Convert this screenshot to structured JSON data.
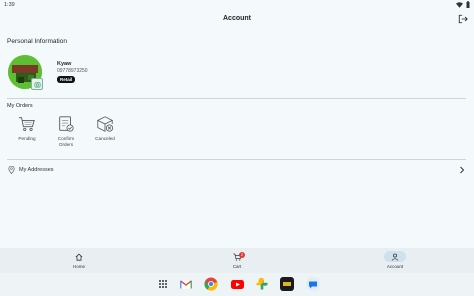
{
  "status_bar": {
    "time": "1:39"
  },
  "app_bar": {
    "title": "Account"
  },
  "personal": {
    "section_title": "Personal Information",
    "name": "Kyaw",
    "phone": "09778973250",
    "badge": "Retail"
  },
  "orders": {
    "title": "My Orders",
    "items": [
      {
        "label": "Pending",
        "icon": "cart-icon"
      },
      {
        "label": "Confirm Orders",
        "icon": "order-confirm-icon"
      },
      {
        "label": "Canceled",
        "icon": "cancel-box-icon"
      }
    ]
  },
  "addresses": {
    "label": "My Addresses"
  },
  "bottom_nav": {
    "items": [
      {
        "label": "Home",
        "icon": "home-icon"
      },
      {
        "label": "Cart",
        "icon": "cart-icon",
        "badge": "2"
      },
      {
        "label": "Account",
        "icon": "person-icon",
        "active": true
      }
    ]
  },
  "taskbar": {
    "apps": [
      "app-grid-icon",
      "gmail-icon",
      "chrome-icon",
      "youtube-icon",
      "photos-icon",
      "app-icon",
      "messages-icon"
    ]
  }
}
